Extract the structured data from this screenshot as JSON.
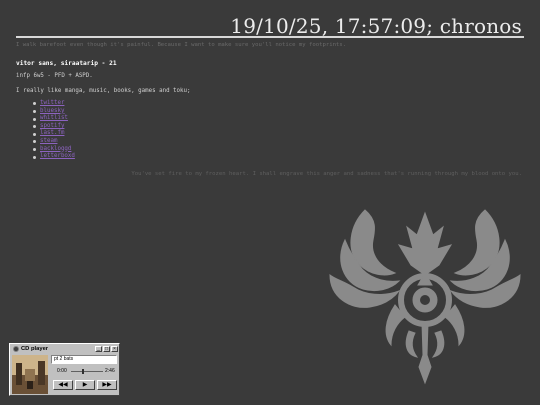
{
  "header": {
    "title": "19/10/25, 17:57:09; chronos"
  },
  "epigraph": "I walk barefoot even though it's painful. Because I want to make sure you'll notice my footprints.",
  "profile": {
    "name": "vitor sans, siraatarip - 21",
    "type": "infp 6w5 - PFD + ASPD.",
    "likes": "I really like manga, music, books, games and toku;"
  },
  "links": [
    "twitter",
    "bluesky",
    "whitlist",
    "spotify",
    "last.fm",
    "steam",
    "backloggd",
    "letterboxd"
  ],
  "quote": "You've set fire to my frozen heart. I shall engrave this anger and sadness that's running through my blood onto you.",
  "cd_player": {
    "title": "CD player",
    "track": "pt 2 bats",
    "time_elapsed": "0:00",
    "time_total": "2:46",
    "progress": 0.35,
    "controls": {
      "prev": "◀◀",
      "play": "▶",
      "next": "▶▶"
    },
    "window_buttons": {
      "minimize": "_",
      "maximize": "□",
      "close": "×"
    }
  },
  "colors": {
    "background": "#3a3a3a",
    "link": "#8c63c0",
    "muted_text": "#6a6a6a",
    "emblem": "#8a8a8a"
  }
}
